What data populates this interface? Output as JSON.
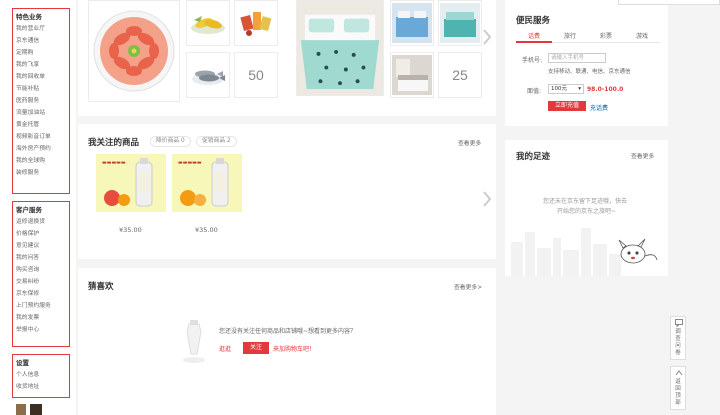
{
  "sidebar": {
    "featured": {
      "title": "特色业务",
      "items": [
        "我的营业厅",
        "京东通信",
        "定期购",
        "我的飞享",
        "我的回收单",
        "节能补贴",
        "医药服务",
        "流量加油站",
        "黄金托管",
        "视频影音订单",
        "海外房产预约",
        "我的全球购",
        "装修服务"
      ]
    },
    "customer": {
      "title": "客户服务",
      "items": [
        "返修退换货",
        "价格保护",
        "意见建议",
        "我的问答",
        "购买咨询",
        "交易纠纷",
        "京东保修",
        "上门预约服务",
        "我的发票",
        "举报中心"
      ]
    },
    "settings": {
      "title": "设置",
      "items": [
        "个人信息",
        "收货地址"
      ]
    }
  },
  "top_cards": {
    "left_count": "50",
    "right_count": "25"
  },
  "follow": {
    "title": "我关注的商品",
    "tabs": [
      "降价商品 0",
      "促销商品 2"
    ],
    "more": "查看更多",
    "items": [
      {
        "price": "¥35.00",
        "image": "juice-bottle-apple"
      },
      {
        "price": "¥35.00",
        "image": "juice-bottle-orange"
      }
    ]
  },
  "guess": {
    "title": "猜喜欢",
    "more": "查看更多>",
    "empty_text": "您还没有关注任何商品和店铺哦~想看到更多内容？",
    "try_label": "逛逛",
    "follow_button": "关注",
    "cart_link": "来加购物车吧！"
  },
  "service": {
    "title": "便民服务",
    "tabs": [
      "话费",
      "旅行",
      "彩票",
      "游戏"
    ],
    "phone_label": "手机号:",
    "phone_placeholder": "请输入手机号",
    "support_text": "支持移动、联通、电信、京东通信",
    "amount_label": "面值:",
    "amount_value": "100元",
    "price_text": "98.0-100.0",
    "recharge_button": "立即充值",
    "quick_link": "充话费"
  },
  "footprint": {
    "title": "我的足迹",
    "more": "查看更多",
    "empty_line1": "您还未在京东留下足迹哦，快去",
    "empty_line2": "开始您的京东之旅吧~"
  },
  "float": {
    "feedback": "调查问卷",
    "top": "返回顶部"
  },
  "colors": {
    "accent": "#e4393c",
    "link": "#005ea7"
  }
}
